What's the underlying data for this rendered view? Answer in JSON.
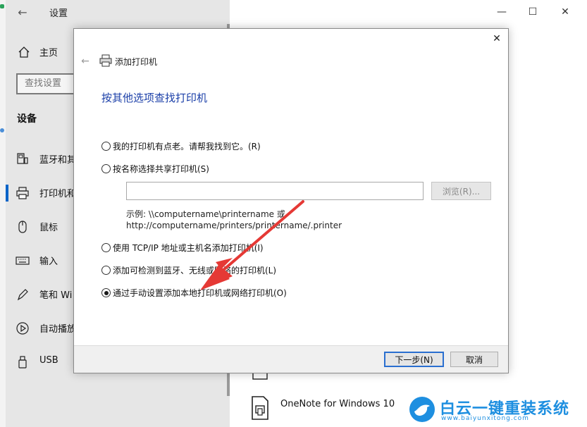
{
  "settings": {
    "title": "设置",
    "home_label": "主页",
    "search_placeholder": "查找设置",
    "section_heading": "设备",
    "nav": [
      {
        "label": "蓝牙和其",
        "icon": "bluetooth-devices-icon"
      },
      {
        "label": "打印机和",
        "icon": "printer-icon"
      },
      {
        "label": "鼠标",
        "icon": "mouse-icon"
      },
      {
        "label": "输入",
        "icon": "keyboard-icon"
      },
      {
        "label": "笔和 Wi",
        "icon": "pen-icon"
      },
      {
        "label": "自动播放",
        "icon": "autoplay-icon"
      },
      {
        "label": "USB",
        "icon": "usb-icon"
      }
    ],
    "list_item": "OneNote for Windows 10"
  },
  "dialog": {
    "title": "添加打印机",
    "heading": "按其他选项查找打印机",
    "options": [
      {
        "label": "我的打印机有点老。请帮我找到它。(R)",
        "checked": false
      },
      {
        "label": "按名称选择共享打印机(S)",
        "checked": false
      },
      {
        "label": "使用 TCP/IP 地址或主机名添加打印机(I)",
        "checked": false
      },
      {
        "label": "添加可检测到蓝牙、无线或网络的打印机(L)",
        "checked": false
      },
      {
        "label": "通过手动设置添加本地打印机或网络打印机(O)",
        "checked": true
      }
    ],
    "browse_label": "浏览(R)...",
    "example_line1": "示例: \\\\computername\\printername 或",
    "example_line2": "http://computername/printers/printername/.printer",
    "next_label": "下一步(N)",
    "cancel_label": "取消"
  },
  "watermark": {
    "text": "白云一键重装系统",
    "url": "www.baiyunxitong.com"
  },
  "colors": {
    "accent": "#1b3fa8",
    "arrow": "#e53935",
    "watermark": "#1e8fe0"
  }
}
